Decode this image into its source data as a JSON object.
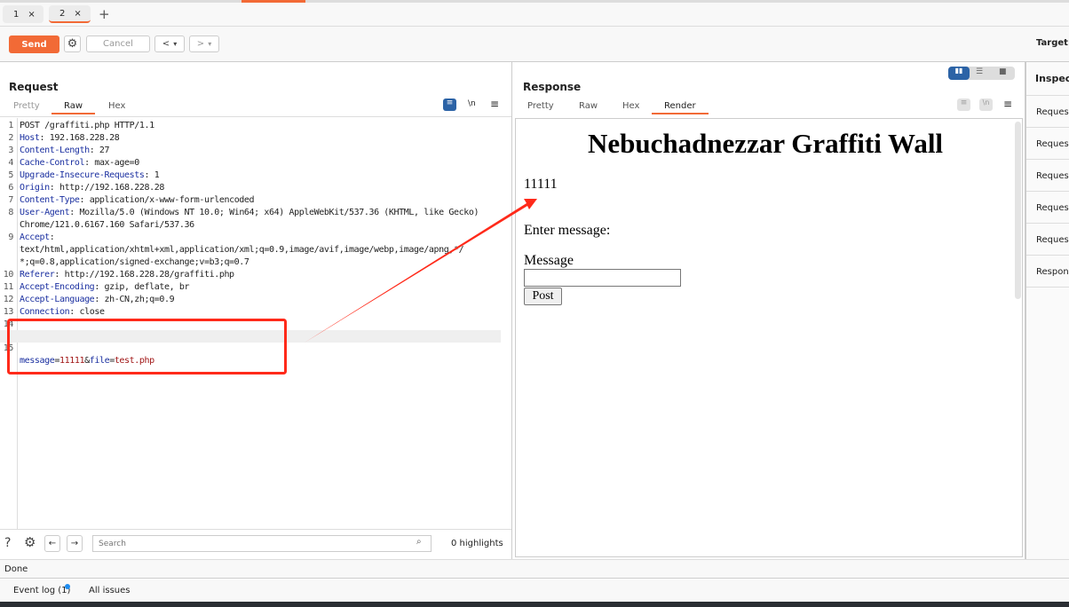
{
  "tabs": [
    {
      "label": "1",
      "close": "×"
    },
    {
      "label": "2",
      "close": "×"
    }
  ],
  "new_tab": "+",
  "toolbar": {
    "send": "Send",
    "cancel": "Cancel",
    "back": "<",
    "forward": ">",
    "dropdown": "▾",
    "target_label": "Target:"
  },
  "request": {
    "title": "Request",
    "tabs": [
      "Pretty",
      "Raw",
      "Hex"
    ],
    "active_tab": "Raw",
    "lines": [
      {
        "n": "1",
        "key": "",
        "text": "POST /graffiti.php HTTP/1.1"
      },
      {
        "n": "2",
        "key": "Host",
        "text": ": 192.168.228.28"
      },
      {
        "n": "3",
        "key": "Content-Length",
        "text": ": 27"
      },
      {
        "n": "4",
        "key": "Cache-Control",
        "text": ": max-age=0"
      },
      {
        "n": "5",
        "key": "Upgrade-Insecure-Requests",
        "text": ": 1"
      },
      {
        "n": "6",
        "key": "Origin",
        "text": ": http://192.168.228.28"
      },
      {
        "n": "7",
        "key": "Content-Type",
        "text": ": application/x-www-form-urlencoded"
      },
      {
        "n": "8",
        "key": "User-Agent",
        "text": ": Mozilla/5.0 (Windows NT 10.0; Win64; x64) AppleWebKit/537.36 (KHTML, like Gecko)"
      },
      {
        "n": "",
        "key": "",
        "text": "Chrome/121.0.6167.160 Safari/537.36"
      },
      {
        "n": "9",
        "key": "Accept",
        "text": ":"
      },
      {
        "n": "",
        "key": "",
        "text": "text/html,application/xhtml+xml,application/xml;q=0.9,image/avif,image/webp,image/apng,*/"
      },
      {
        "n": "",
        "key": "",
        "text": "*;q=0.8,application/signed-exchange;v=b3;q=0.7"
      },
      {
        "n": "10",
        "key": "Referer",
        "text": ": http://192.168.228.28/graffiti.php"
      },
      {
        "n": "11",
        "key": "Accept-Encoding",
        "text": ": gzip, deflate, br"
      },
      {
        "n": "12",
        "key": "Accept-Language",
        "text": ": zh-CN,zh;q=0.9"
      },
      {
        "n": "13",
        "key": "Connection",
        "text": ": close"
      },
      {
        "n": "14",
        "key": "",
        "text": ""
      }
    ],
    "body_line": {
      "n": "15",
      "p1": "message",
      "eq1": "=",
      "v1": "11111",
      "amp": "&",
      "p2": "file",
      "eq2": "=",
      "v2": "test.php"
    },
    "search_placeholder": "Search",
    "highlights": "0 highlights"
  },
  "response": {
    "title": "Response",
    "tabs": [
      "Pretty",
      "Raw",
      "Hex",
      "Render"
    ],
    "active_tab": "Render",
    "render": {
      "heading": "Nebuchadnezzar Graffiti Wall",
      "message": "11111",
      "prompt": "Enter message:",
      "label": "Message",
      "input_value": "",
      "button": "Post"
    }
  },
  "inspector": {
    "title": "Inspect",
    "rows": [
      "Request",
      "Request",
      "Request",
      "Request",
      "Request",
      "Respons"
    ]
  },
  "status": "Done",
  "bottom": {
    "event_log": "Event log (1)",
    "all_issues": "All issues"
  },
  "colors": {
    "accent": "#f26a36",
    "annotation": "#ff2a1a",
    "active_blue": "#2c63a6"
  }
}
